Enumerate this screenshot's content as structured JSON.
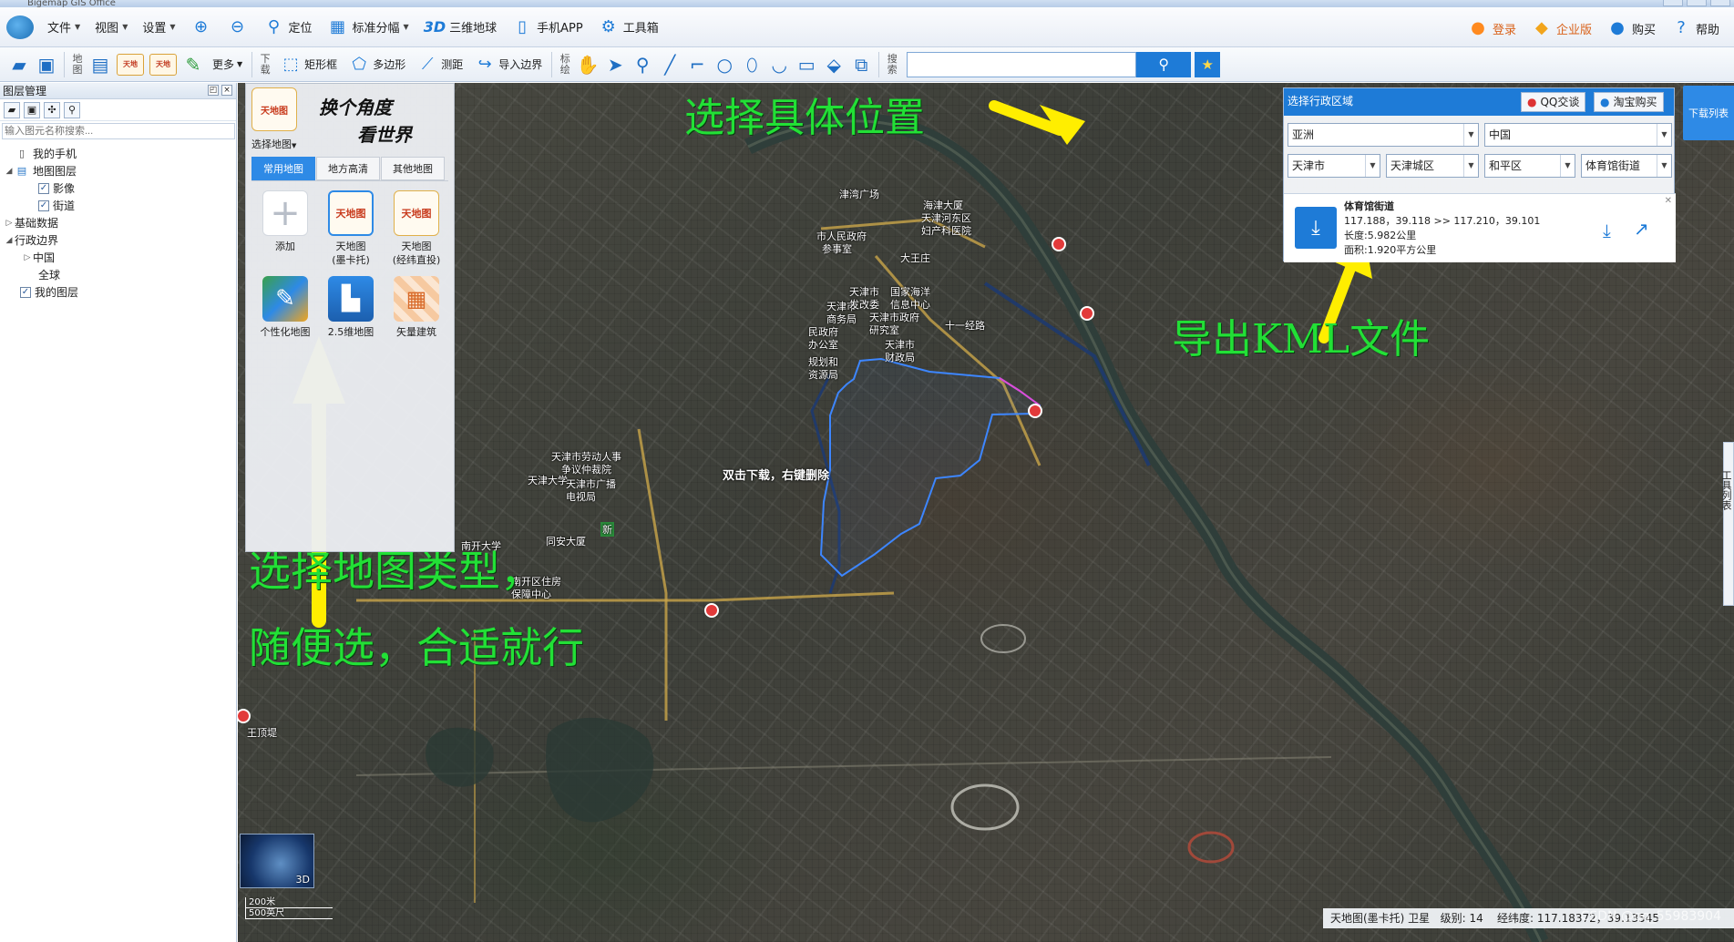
{
  "window": {
    "title": "Bigemap GIS Office"
  },
  "menubar": {
    "items": [
      {
        "label": "文件",
        "icon": "file-icon"
      },
      {
        "label": "视图",
        "icon": "view-icon"
      },
      {
        "label": "设置",
        "icon": "settings-icon"
      }
    ],
    "tools": [
      {
        "label": "",
        "icon": "zoom-in-icon"
      },
      {
        "label": "",
        "icon": "zoom-out-icon"
      },
      {
        "label": "定位",
        "icon": "location-pin-icon"
      },
      {
        "label": "标准分幅",
        "icon": "grid-icon"
      },
      {
        "label": "三维地球",
        "icon": "3d-icon",
        "badge": "3D"
      },
      {
        "label": "手机APP",
        "icon": "phone-icon"
      },
      {
        "label": "工具箱",
        "icon": "gear-icon"
      }
    ],
    "right": [
      {
        "label": "登录",
        "icon": "user-icon"
      },
      {
        "label": "企业版",
        "icon": "diamond-icon"
      },
      {
        "label": "购买",
        "icon": "buy-icon"
      },
      {
        "label": "帮助",
        "icon": "help-icon"
      }
    ]
  },
  "toolbar": {
    "group1_label": "地图",
    "more_label": "更多",
    "group2_label": "下载",
    "rect_label": "矩形框",
    "polygon_label": "多边形",
    "measure_label": "测距",
    "import_label": "导入边界",
    "group3_label": "标绘",
    "group4_label": "搜索",
    "search_placeholder": ""
  },
  "leftpanel": {
    "title": "图层管理",
    "search_placeholder": "输入图元名称搜索...",
    "tree": [
      {
        "label": "我的手机",
        "level": 1,
        "type": "folder"
      },
      {
        "label": "地图图层",
        "level": 0,
        "type": "folder",
        "expanded": true
      },
      {
        "label": "影像",
        "level": 2,
        "type": "check",
        "checked": true
      },
      {
        "label": "街道",
        "level": 2,
        "type": "check",
        "checked": true
      },
      {
        "label": "基础数据",
        "level": 0,
        "type": "plain",
        "expanded": false
      },
      {
        "label": "行政边界",
        "level": 0,
        "type": "plain",
        "expanded": true
      },
      {
        "label": "中国",
        "level": 1,
        "type": "plain",
        "expanded": false
      },
      {
        "label": "全球",
        "level": 2,
        "type": "plain"
      },
      {
        "label": "我的图层",
        "level": 1,
        "type": "check",
        "checked": true
      }
    ]
  },
  "mapchooser": {
    "logo_text": "天地图",
    "select_label": "选择地图",
    "slogan1": "换个角度",
    "slogan2": "看世界",
    "tabs": [
      "常用地图",
      "地方高清",
      "其他地图"
    ],
    "active_tab": 0,
    "items": [
      {
        "label": "添加",
        "icon": "plus-icon"
      },
      {
        "label": "天地图\n(墨卡托)",
        "icon": "tianditu-logo-icon"
      },
      {
        "label": "天地图\n(经纬直投)",
        "icon": "tianditu-logo-icon"
      },
      {
        "label": "个性化地图",
        "icon": "custom-map-icon"
      },
      {
        "label": "2.5维地图",
        "icon": "map-25d-icon"
      },
      {
        "label": "矢量建筑",
        "icon": "vector-building-icon"
      }
    ]
  },
  "regionpanel": {
    "title": "选择行政区域",
    "qq_label": "QQ交谈",
    "taobao_label": "淘宝购买",
    "continent": "亚洲",
    "country": "中国",
    "province": "天津市",
    "district": "天津城区",
    "county": "和平区",
    "street": "体育馆街道",
    "result": {
      "name": "体育馆街道",
      "coords": "117.188，39.118 >> 117.210，39.101",
      "length": "长度:5.982公里",
      "area": "面积:1.920平方公里"
    }
  },
  "download_list_label": "下载列表",
  "side_tab_label": "工具列表",
  "map_labels": [
    {
      "text": "海津大厦"
    },
    {
      "text": "天津河东区"
    },
    {
      "text": "妇产科医院"
    },
    {
      "text": "津湾广场"
    },
    {
      "text": "市人民政府"
    },
    {
      "text": "参事室"
    },
    {
      "text": "大王庄"
    },
    {
      "text": "天津市"
    },
    {
      "text": "商务局"
    },
    {
      "text": "天津市"
    },
    {
      "text": "发改委"
    },
    {
      "text": "国家海洋"
    },
    {
      "text": "信息中心"
    },
    {
      "text": "天津市政府"
    },
    {
      "text": "研究室"
    },
    {
      "text": "十一经路"
    },
    {
      "text": "民政府"
    },
    {
      "text": "办公室"
    },
    {
      "text": "天津市"
    },
    {
      "text": "财政局"
    },
    {
      "text": "规划和"
    },
    {
      "text": "资源局"
    },
    {
      "text": "双击下载，右键删除"
    },
    {
      "text": "天津市劳动人事"
    },
    {
      "text": "争议仲裁院"
    },
    {
      "text": "天津大学"
    },
    {
      "text": "天津市广播"
    },
    {
      "text": "电视局"
    },
    {
      "text": "南开大学"
    },
    {
      "text": "同安大厦"
    },
    {
      "text": "南开区住房"
    },
    {
      "text": "保障中心"
    },
    {
      "text": "王顶堤"
    },
    {
      "text": "新"
    }
  ],
  "annotations": {
    "top": "选择具体位置",
    "right": "导出KML文件",
    "bottom1": "选择地图类型，",
    "bottom2": "随便选，合适就行"
  },
  "globe_label": "3D",
  "scale": {
    "metric": "200米",
    "imperial": "500英尺"
  },
  "statusbar": {
    "map_name": "天地图(墨卡托) 卫星",
    "level": "级别:  14",
    "coords": "经纬度: 117.18372，39.13545"
  },
  "watermark": "CSDN @qq_55983904",
  "colors": {
    "accent": "#1e7bd7",
    "annotation": "#22e036",
    "arrow": "#ffee00",
    "boundary": "#3d86ff"
  }
}
